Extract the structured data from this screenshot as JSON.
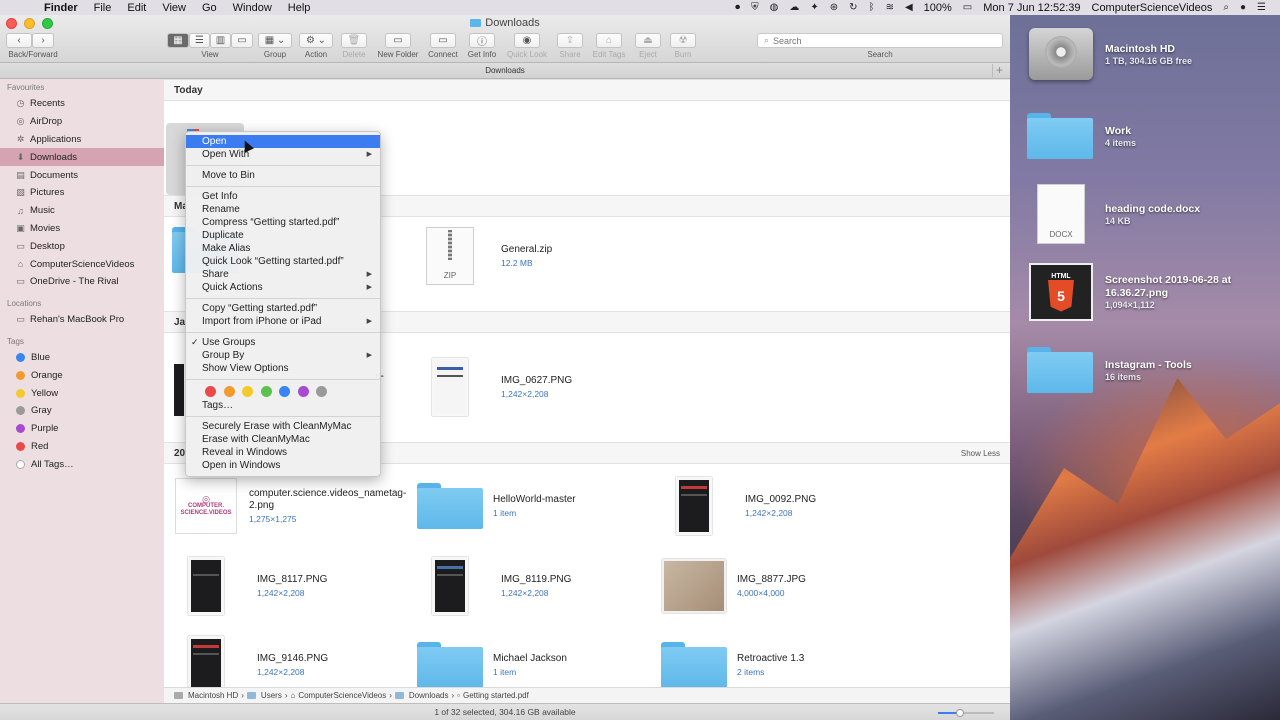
{
  "menubar": {
    "app": "Finder",
    "items": [
      "File",
      "Edit",
      "View",
      "Go",
      "Window",
      "Help"
    ],
    "battery": "100%",
    "datetime": "Mon 7 Jun  12:52:39",
    "user": "ComputerScienceVideos"
  },
  "window": {
    "title": "Downloads",
    "path_title": "Downloads"
  },
  "toolbar": {
    "back_forward": "Back/Forward",
    "view": "View",
    "group": "Group",
    "action": "Action",
    "delete": "Delete",
    "new_folder": "New Folder",
    "connect": "Connect",
    "get_info": "Get Info",
    "quick_look": "Quick Look",
    "share": "Share",
    "edit_tags": "Edit Tags",
    "eject": "Eject",
    "burn": "Burn",
    "search_label": "Search",
    "search_placeholder": "Search"
  },
  "sidebar": {
    "favourites_heading": "Favourites",
    "favourites": [
      {
        "label": "Recents",
        "icon": "clock-icon"
      },
      {
        "label": "AirDrop",
        "icon": "airdrop-icon"
      },
      {
        "label": "Applications",
        "icon": "applications-icon"
      },
      {
        "label": "Downloads",
        "icon": "downloads-icon"
      },
      {
        "label": "Documents",
        "icon": "document-icon"
      },
      {
        "label": "Pictures",
        "icon": "pictures-icon"
      },
      {
        "label": "Music",
        "icon": "music-icon"
      },
      {
        "label": "Movies",
        "icon": "movies-icon"
      },
      {
        "label": "Desktop",
        "icon": "desktop-icon"
      },
      {
        "label": "ComputerScienceVideos",
        "icon": "home-icon"
      },
      {
        "label": "OneDrive - The Rival",
        "icon": "folder-icon"
      }
    ],
    "locations_heading": "Locations",
    "locations": [
      {
        "label": "Rehan's MacBook Pro",
        "icon": "laptop-icon"
      }
    ],
    "tags_heading": "Tags",
    "tags": [
      {
        "label": "Blue",
        "color": "#3a86f0"
      },
      {
        "label": "Orange",
        "color": "#f39a2e"
      },
      {
        "label": "Yellow",
        "color": "#f4c92c"
      },
      {
        "label": "Gray",
        "color": "#9a9a9a"
      },
      {
        "label": "Purple",
        "color": "#a64bd1"
      },
      {
        "label": "Red",
        "color": "#ec4a4a"
      },
      {
        "label": "All Tags…",
        "color": "#d0d0d0"
      }
    ]
  },
  "sections": {
    "today": "Today",
    "ma": "Ma",
    "ja": "Ja",
    "twenty": "20",
    "show_less": "Show Less"
  },
  "files": {
    "general_zip": {
      "name": "General.zip",
      "meta": "12.2 MB",
      "ext": "ZIP"
    },
    "img_0627": {
      "name": "IMG_0627.PNG",
      "meta": "1,242×2,208"
    },
    "partial_e": {
      "name": "e-"
    },
    "computer_science": {
      "name": "computer.science.videos_nametag-2.png",
      "meta": "1,275×1,275",
      "thumb_text": "COMPUTER. SCIENCE.VIDEOS"
    },
    "helloworld": {
      "name": "HelloWorld-master",
      "meta": "1 item"
    },
    "img_0092": {
      "name": "IMG_0092.PNG",
      "meta": "1,242×2,208"
    },
    "img_8117": {
      "name": "IMG_8117.PNG",
      "meta": "1,242×2,208"
    },
    "img_8119": {
      "name": "IMG_8119.PNG",
      "meta": "1,242×2,208"
    },
    "img_8877": {
      "name": "IMG_8877.JPG",
      "meta": "4,000×4,000"
    },
    "img_9146": {
      "name": "IMG_9146.PNG",
      "meta": "1,242×2,208"
    },
    "michael_jackson": {
      "name": "Michael Jackson",
      "meta": "1 item"
    },
    "retroactive": {
      "name": "Retroactive 1.3",
      "meta": "2 items"
    }
  },
  "context_menu": {
    "open": "Open",
    "open_with": "Open With",
    "move_to_bin": "Move to Bin",
    "get_info": "Get Info",
    "rename": "Rename",
    "compress": "Compress “Getting started.pdf”",
    "duplicate": "Duplicate",
    "make_alias": "Make Alias",
    "quick_look": "Quick Look “Getting started.pdf”",
    "share": "Share",
    "quick_actions": "Quick Actions",
    "copy": "Copy “Getting started.pdf”",
    "import_iphone": "Import from iPhone or iPad",
    "use_groups": "Use Groups",
    "group_by": "Group By",
    "show_view_options": "Show View Options",
    "tag_colors": [
      "#ec4a4a",
      "#f39a2e",
      "#f4c92c",
      "#5ac24f",
      "#3a86f0",
      "#a64bd1",
      "#9a9a9a"
    ],
    "tags": "Tags…",
    "secure_erase": "Securely Erase with CleanMyMac",
    "erase": "Erase with CleanMyMac",
    "reveal_windows": "Reveal in Windows",
    "open_windows": "Open in Windows"
  },
  "pathbar": [
    "Macintosh HD",
    "Users",
    "ComputerScienceVideos",
    "Downloads",
    "Getting started.pdf"
  ],
  "statusbar": {
    "text": "1 of 32 selected, 304.16 GB available",
    "icon_size_fraction": 0.4
  },
  "desktop": {
    "hd": {
      "name": "Macintosh HD",
      "meta": "1 TB, 304.16 GB free"
    },
    "work": {
      "name": "Work",
      "meta": "4 items"
    },
    "docx": {
      "name": "heading code.docx",
      "meta": "14 KB",
      "ext": "DOCX"
    },
    "screenshot": {
      "name": "Screenshot 2019-06-28 at 16.36.27.png",
      "meta": "1,094×1,112",
      "badge": "HTML"
    },
    "instagram": {
      "name": "Instagram - Tools",
      "meta": "16 items"
    }
  }
}
